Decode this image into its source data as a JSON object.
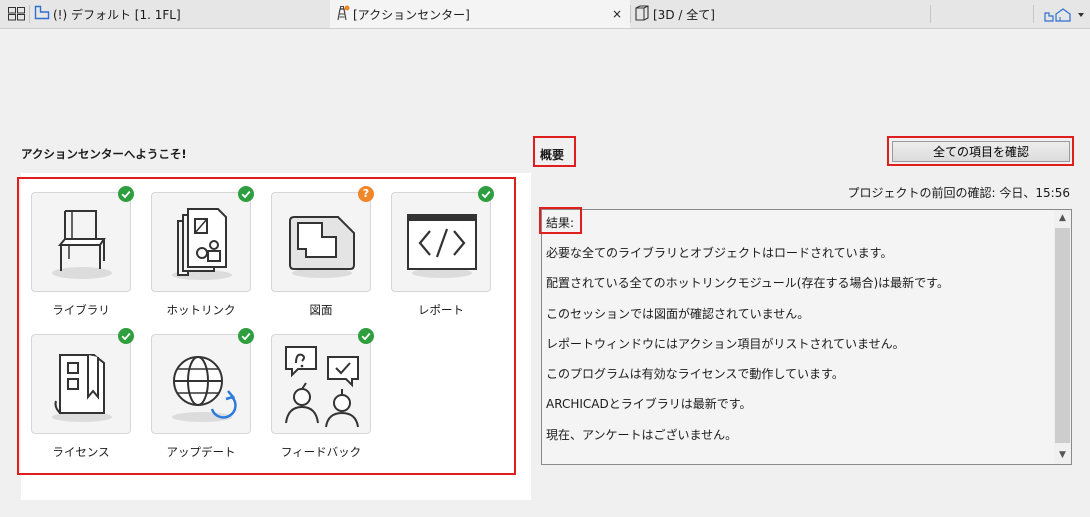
{
  "tabs": [
    {
      "label": "(!) デフォルト [1. 1FL]",
      "active": false
    },
    {
      "label": "[アクションセンター]",
      "active": true
    },
    {
      "label": "[3D / 全て]",
      "active": false
    }
  ],
  "tab_close_glyph": "×",
  "welcome": "アクションセンターへようこそ!",
  "tiles": [
    {
      "label": "ライブラリ",
      "icon": "chair-icon",
      "status": "ok"
    },
    {
      "label": "ホットリンク",
      "icon": "hotlink-icon",
      "status": "ok"
    },
    {
      "label": "図面",
      "icon": "drawing-icon",
      "status": "unknown",
      "status_text": "?"
    },
    {
      "label": "レポート",
      "icon": "report-code-icon",
      "status": "ok"
    },
    {
      "label": "ライセンス",
      "icon": "license-icon",
      "status": "ok"
    },
    {
      "label": "アップデート",
      "icon": "globe-update-icon",
      "status": "ok"
    },
    {
      "label": "フィードバック",
      "icon": "feedback-icon",
      "status": "ok"
    }
  ],
  "overview": {
    "title": "概要",
    "check_all_button": "全ての項目を確認",
    "last_check": "プロジェクトの前回の確認: 今日、15:56",
    "results_title": "結果:",
    "results": [
      "必要な全てのライブラリとオブジェクトはロードされています。",
      "配置されている全てのホットリンクモジュール(存在する場合)は最新です。",
      "このセッションでは図面が確認されていません。",
      "レポートウィンドウにはアクション項目がリストされていません。",
      "このプログラムは有効なライセンスで動作しています。",
      "ARCHICADとライブラリは最新です。",
      "現在、アンケートはございません。"
    ]
  },
  "colors": {
    "ok": "#2e9e3e",
    "warning": "#f0862a",
    "highlight": "#e01e1e",
    "update_accent": "#2b7bdc"
  }
}
